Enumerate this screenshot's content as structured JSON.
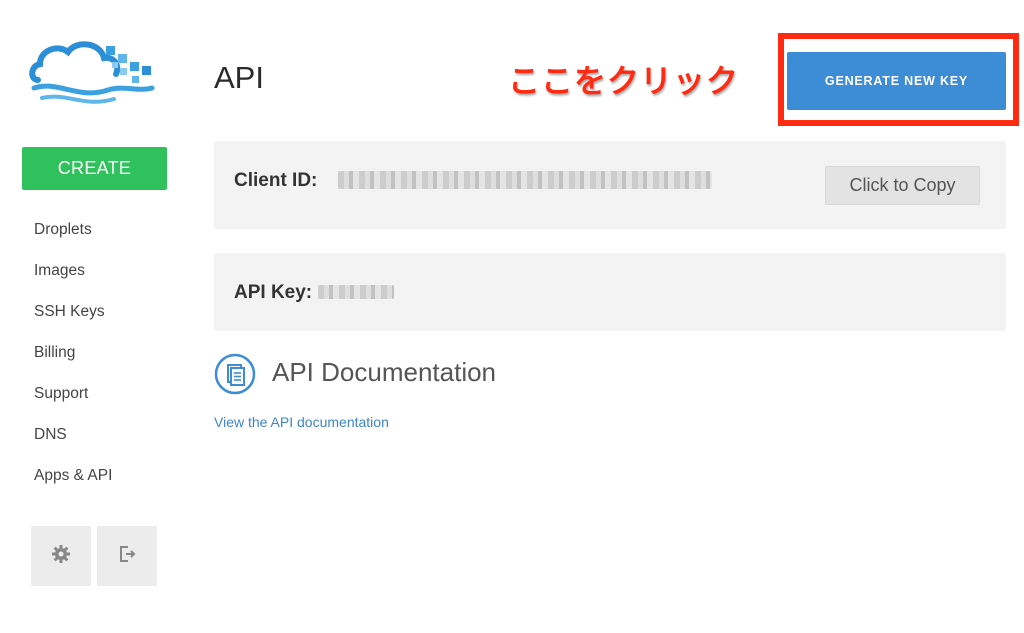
{
  "sidebar": {
    "create_label": "CREATE",
    "items": [
      {
        "label": "Droplets"
      },
      {
        "label": "Images"
      },
      {
        "label": "SSH Keys"
      },
      {
        "label": "Billing"
      },
      {
        "label": "Support"
      },
      {
        "label": "DNS"
      },
      {
        "label": "Apps & API"
      }
    ],
    "util_icons": [
      "gear-icon",
      "logout-icon"
    ]
  },
  "header": {
    "title": "API",
    "annotation": "ここをクリック",
    "generate_label": "GENERATE NEW KEY"
  },
  "client": {
    "label": "Client ID:",
    "copy_label": "Click to Copy"
  },
  "apikey": {
    "label": "API Key:"
  },
  "docs": {
    "title": "API Documentation",
    "link_text": "View the API documentation",
    "icon": "document-icon"
  },
  "colors": {
    "create": "#2fc15b",
    "primary": "#3d8cd6",
    "annotation": "#ff2a12",
    "link": "#3d86c6",
    "panel": "#f3f3f3"
  }
}
